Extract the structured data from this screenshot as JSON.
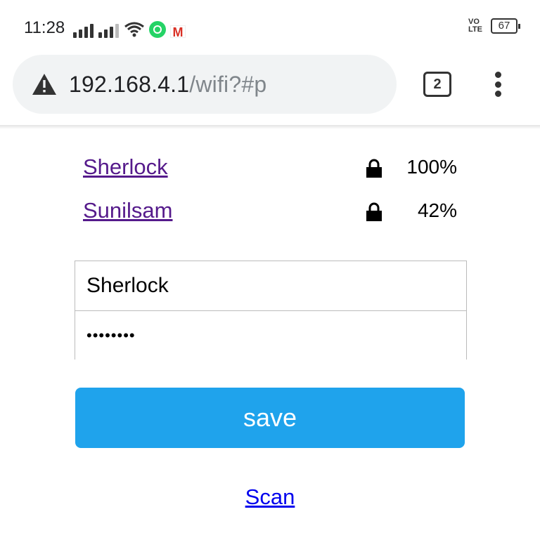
{
  "status_bar": {
    "time": "11:28",
    "network_label": "VO\nLTE",
    "battery": "67"
  },
  "browser": {
    "url_host": "192.168.4.1",
    "url_path": "/wifi?#p",
    "tab_count": "2",
    "security_icon": "warning-triangle-icon"
  },
  "networks": [
    {
      "ssid": "Sherlock",
      "secured": true,
      "signal": "100%"
    },
    {
      "ssid": "Sunilsam",
      "secured": true,
      "signal": "42%"
    }
  ],
  "form": {
    "ssid_value": "Sherlock",
    "password_value": "••••••••"
  },
  "buttons": {
    "save_label": "save",
    "scan_label": "Scan"
  },
  "colors": {
    "visited_link": "#551a8b",
    "link": "#0000ee",
    "save_button": "#1fa3ec"
  }
}
